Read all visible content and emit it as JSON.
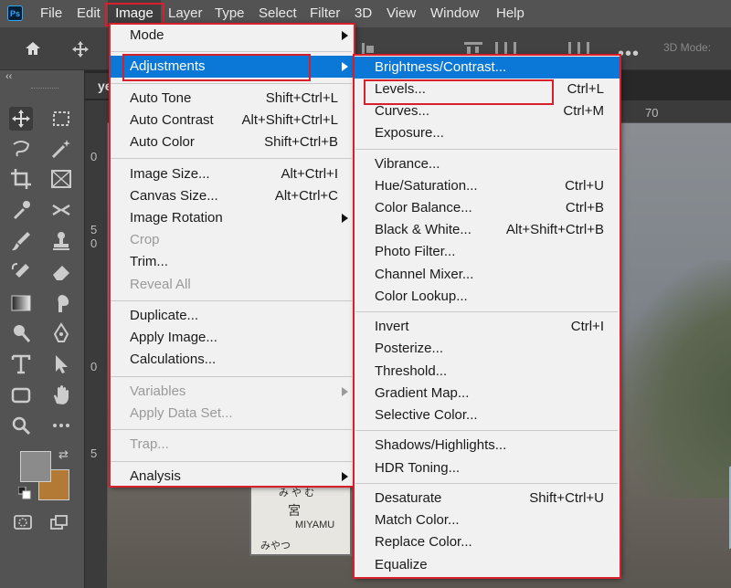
{
  "app": {
    "logo": "Ps"
  },
  "menubar": {
    "items": [
      "File",
      "Edit",
      "Image",
      "Layer",
      "Type",
      "Select",
      "Filter",
      "3D",
      "View",
      "Window",
      "Help"
    ],
    "active": "Image"
  },
  "optionsbar": {
    "mode_3d": "3D Mode:"
  },
  "document": {
    "tab_label": "ye",
    "ruler_top_label": "70",
    "ruler_left_labels": [
      "0",
      "5",
      "0",
      "0",
      "5"
    ],
    "sign_text": [
      "み や む",
      "宮",
      "MIYAMU",
      "みやつ"
    ]
  },
  "colors": {
    "foreground": "#8b8b8b",
    "background": "#b27a35",
    "highlight": "#0b78d8",
    "annotation": "#d8202c"
  },
  "image_menu": {
    "items": [
      {
        "label": "Mode",
        "shortcut": "",
        "submenu": true
      },
      {
        "sep": true
      },
      {
        "label": "Adjustments",
        "shortcut": "",
        "submenu": true,
        "highlighted": true
      },
      {
        "sep": true
      },
      {
        "label": "Auto Tone",
        "shortcut": "Shift+Ctrl+L"
      },
      {
        "label": "Auto Contrast",
        "shortcut": "Alt+Shift+Ctrl+L"
      },
      {
        "label": "Auto Color",
        "shortcut": "Shift+Ctrl+B"
      },
      {
        "sep": true
      },
      {
        "label": "Image Size...",
        "shortcut": "Alt+Ctrl+I"
      },
      {
        "label": "Canvas Size...",
        "shortcut": "Alt+Ctrl+C"
      },
      {
        "label": "Image Rotation",
        "shortcut": "",
        "submenu": true
      },
      {
        "label": "Crop",
        "shortcut": "",
        "disabled": true
      },
      {
        "label": "Trim...",
        "shortcut": ""
      },
      {
        "label": "Reveal All",
        "shortcut": "",
        "disabled": true
      },
      {
        "sep": true
      },
      {
        "label": "Duplicate...",
        "shortcut": ""
      },
      {
        "label": "Apply Image...",
        "shortcut": ""
      },
      {
        "label": "Calculations...",
        "shortcut": ""
      },
      {
        "sep": true
      },
      {
        "label": "Variables",
        "shortcut": "",
        "submenu": true,
        "disabled": true
      },
      {
        "label": "Apply Data Set...",
        "shortcut": "",
        "disabled": true
      },
      {
        "sep": true
      },
      {
        "label": "Trap...",
        "shortcut": "",
        "disabled": true
      },
      {
        "sep": true
      },
      {
        "label": "Analysis",
        "shortcut": "",
        "submenu": true
      }
    ]
  },
  "adjustments_menu": {
    "items": [
      {
        "label": "Brightness/Contrast...",
        "shortcut": "",
        "highlighted": true
      },
      {
        "label": "Levels...",
        "shortcut": "Ctrl+L"
      },
      {
        "label": "Curves...",
        "shortcut": "Ctrl+M"
      },
      {
        "label": "Exposure...",
        "shortcut": ""
      },
      {
        "sep": true
      },
      {
        "label": "Vibrance...",
        "shortcut": ""
      },
      {
        "label": "Hue/Saturation...",
        "shortcut": "Ctrl+U"
      },
      {
        "label": "Color Balance...",
        "shortcut": "Ctrl+B"
      },
      {
        "label": "Black & White...",
        "shortcut": "Alt+Shift+Ctrl+B"
      },
      {
        "label": "Photo Filter...",
        "shortcut": ""
      },
      {
        "label": "Channel Mixer...",
        "shortcut": ""
      },
      {
        "label": "Color Lookup...",
        "shortcut": ""
      },
      {
        "sep": true
      },
      {
        "label": "Invert",
        "shortcut": "Ctrl+I"
      },
      {
        "label": "Posterize...",
        "shortcut": ""
      },
      {
        "label": "Threshold...",
        "shortcut": ""
      },
      {
        "label": "Gradient Map...",
        "shortcut": ""
      },
      {
        "label": "Selective Color...",
        "shortcut": ""
      },
      {
        "sep": true
      },
      {
        "label": "Shadows/Highlights...",
        "shortcut": ""
      },
      {
        "label": "HDR Toning...",
        "shortcut": ""
      },
      {
        "sep": true
      },
      {
        "label": "Desaturate",
        "shortcut": "Shift+Ctrl+U"
      },
      {
        "label": "Match Color...",
        "shortcut": ""
      },
      {
        "label": "Replace Color...",
        "shortcut": ""
      },
      {
        "label": "Equalize",
        "shortcut": ""
      }
    ]
  }
}
